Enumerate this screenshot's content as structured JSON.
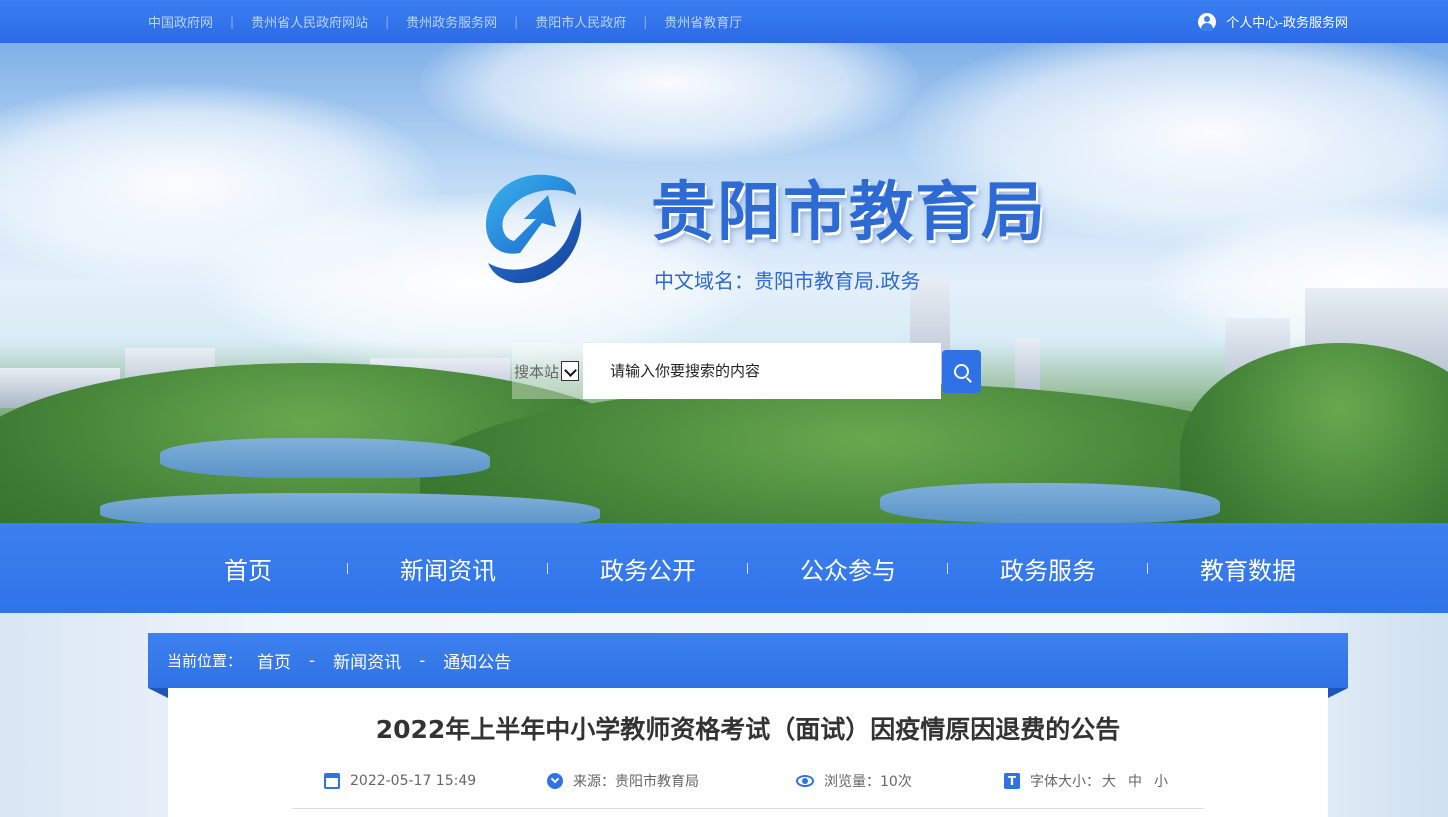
{
  "topbar": {
    "links": [
      "中国政府网",
      "贵州省人民政府网站",
      "贵州政务服务网",
      "贵阳市人民政府",
      "贵州省教育厅"
    ],
    "user_link": "个人中心-政务服务网"
  },
  "header": {
    "site_title": "贵阳市教育局",
    "domain_line": "中文域名：贵阳市教育局.政务"
  },
  "search": {
    "scope_label": "搜本站",
    "placeholder": "请输入你要搜索的内容"
  },
  "nav": {
    "items": [
      "首页",
      "新闻资讯",
      "政务公开",
      "公众参与",
      "政务服务",
      "教育数据"
    ]
  },
  "breadcrumb": {
    "label": "当前位置：",
    "items": [
      "首页",
      "新闻资讯",
      "通知公告"
    ],
    "separator": "-"
  },
  "article": {
    "title": "2022年上半年中小学教师资格考试（面试）因疫情原因退费的公告",
    "date": "2022-05-17 15:49",
    "source": "来源：贵阳市教育局",
    "views": "浏览量：10次",
    "font_size_label": "字体大小：",
    "font_sizes": [
      "大",
      "中",
      "小"
    ],
    "font_icon_letter": "T"
  },
  "colors": {
    "primary": "#2e72e6",
    "title_blue": "#2d6ad4"
  }
}
